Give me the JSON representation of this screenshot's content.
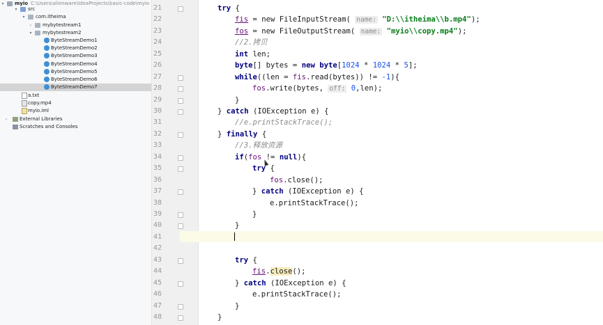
{
  "project_tree": {
    "root_name": "myio",
    "root_path": "C:\\Users\\alienware\\IdeaProjects\\basic-code\\myio",
    "src": "src",
    "package": "com.itheima",
    "folders": [
      "mybytestream1",
      "mybytestream2"
    ],
    "classes": [
      "ByteStreamDemo1",
      "ByteStreamDemo2",
      "ByteStreamDemo3",
      "ByteStreamDemo4",
      "ByteStreamDemo5",
      "ByteStreamDemo6",
      "ByteStreamDemo7"
    ],
    "selected_class": "ByteStreamDemo7",
    "files": [
      "a.txt",
      "copy.mp4",
      "myio.iml"
    ],
    "external_libraries": "External Libraries",
    "scratches": "Scratches and Consoles"
  },
  "editor": {
    "line_numbers": [
      "21",
      "22",
      "23",
      "24",
      "25",
      "26",
      "27",
      "28",
      "29",
      "30",
      "31",
      "32",
      "33",
      "34",
      "35",
      "36",
      "37",
      "38",
      "39",
      "40",
      "41",
      "42",
      "43",
      "44",
      "45",
      "46",
      "47",
      "48"
    ],
    "current_line": "41",
    "code": {
      "try1": "try",
      "brace_open": "{",
      "fis_var": "fis",
      "new_fis": " = new ",
      "fis_class": "FileInputStream(",
      "hint_name1": "name:",
      "path_in": "\"D:\\\\itheima\\\\b.mp4\"",
      "close_paren": ");",
      "fos_var": "fos",
      "fos_class": "FileOutputStream(",
      "hint_name2": "name:",
      "path_out": "\"myio\\\\copy.mp4\"",
      "comment_copy": "//2.拷贝",
      "int_kw": "int",
      "len_decl": " len;",
      "byte_kw": "byte",
      "bytes_decl": "[] bytes = ",
      "new_kw": "new",
      "byte_kw2": "byte",
      "n1024a": "1024",
      "times": " * ",
      "n1024b": "1024",
      "n5": "5",
      "while_kw": "while",
      "while_rest1": "((len = ",
      "read_call": ".read(bytes)) != ",
      "neg1": "-1",
      "while_end": "){",
      "write_call": ".write(bytes, ",
      "hint_off": "off:",
      "zero": "0",
      "write_end": ",len);",
      "brace_close": "}",
      "catch_kw": "catch",
      "catch_rest": " (IOException e) {",
      "comment_print": "//e.printStackTrace();",
      "finally_kw": "finally",
      "comment_release": "//3.释放资源",
      "if_kw": "if",
      "if_open": "(",
      "not_null": " != ",
      "null_kw": "null",
      "if_end": "){",
      "try2": "try",
      "close_call": ".close();",
      "close_method": "close",
      "call_end": "();",
      "print_stack": "e.printStackTrace();",
      "dot": "."
    }
  },
  "colors": {
    "keyword": "#00007f",
    "string": "#067d17",
    "number": "#1750eb",
    "comment": "#8c8c8c",
    "field": "#660e7a",
    "selection": "#d4d4d4",
    "current_line": "#fcfbe8"
  }
}
